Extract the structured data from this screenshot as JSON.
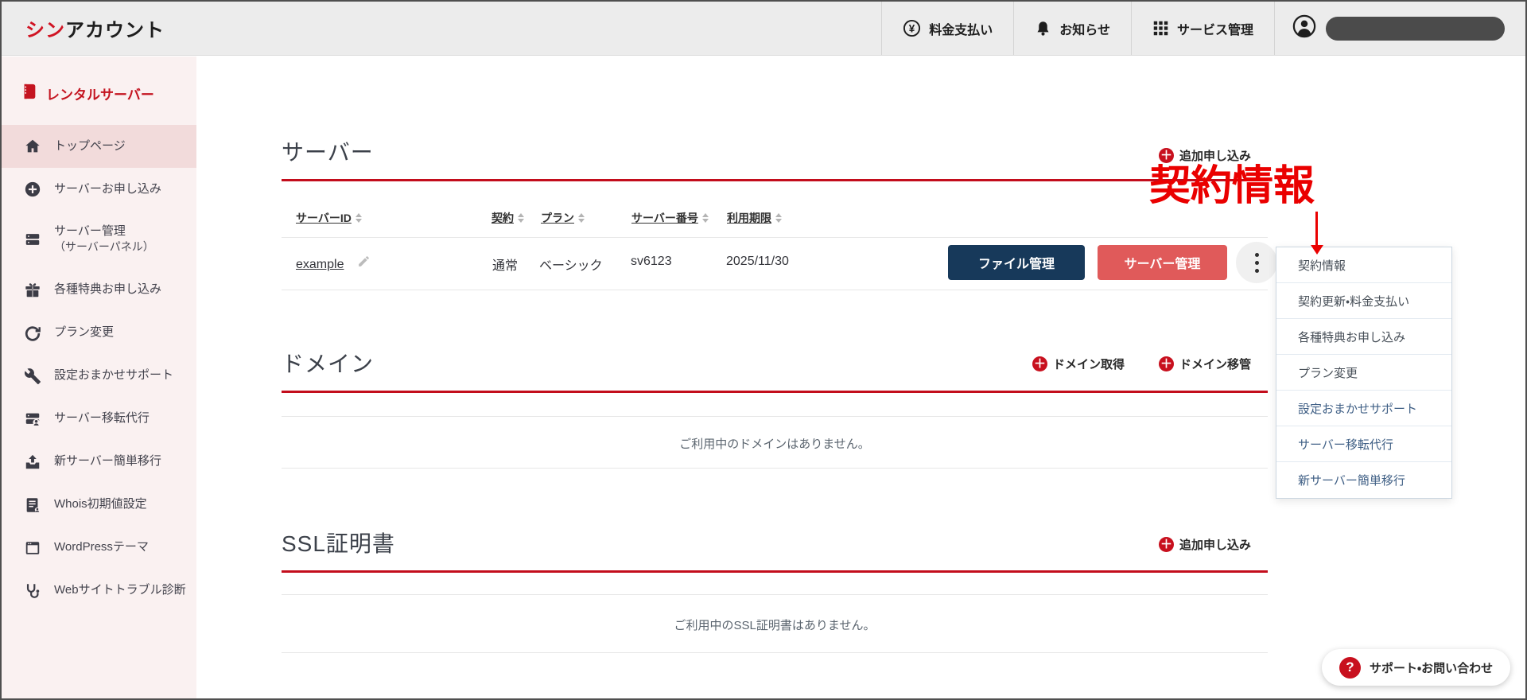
{
  "colors": {
    "brand_red": "#d01423",
    "accent_line_red": "#c30d1c",
    "annotation_red": "#ea0000",
    "navy_button": "#17395a",
    "salmon_button": "#e05a5a",
    "menu_link_blue": "#3f5f85",
    "sidebar_bg": "#faf1f1",
    "sidebar_active_bg": "#f2dbdb",
    "header_bg": "#ececec"
  },
  "header": {
    "logo_accent": "シン",
    "logo_rest": "アカウント",
    "nav": [
      {
        "label": "料金支払い",
        "icon": "yen-icon"
      },
      {
        "label": "お知らせ",
        "icon": "bell-icon"
      },
      {
        "label": "サービス管理",
        "icon": "grid-icon"
      }
    ]
  },
  "sidebar": {
    "title": "レンタルサーバー",
    "items": [
      {
        "label": "トップページ",
        "icon": "home-icon",
        "active": true
      },
      {
        "label": "サーバーお申し込み",
        "icon": "plus-circle-icon"
      },
      {
        "label": "サーバー管理",
        "sub": "（サーバーパネル）",
        "icon": "server-icon"
      },
      {
        "label": "各種特典お申し込み",
        "icon": "gift-icon"
      },
      {
        "label": "プラン変更",
        "icon": "refresh-icon"
      },
      {
        "label": "設定おまかせサポート",
        "icon": "wrench-icon"
      },
      {
        "label": "サーバー移転代行",
        "icon": "server-move-icon"
      },
      {
        "label": "新サーバー簡単移行",
        "icon": "migrate-icon"
      },
      {
        "label": "Whois初期値設定",
        "icon": "whois-doc-icon"
      },
      {
        "label": "WordPressテーマ",
        "icon": "browser-window-icon"
      },
      {
        "label": "Webサイトトラブル診断",
        "icon": "stethoscope-icon"
      }
    ]
  },
  "server_section": {
    "title": "サーバー",
    "add_label": "追加申し込み",
    "columns": [
      "サーバーID",
      "契約",
      "プラン",
      "サーバー番号",
      "利用期限"
    ],
    "row": {
      "server_id": "example",
      "contract": "通常",
      "plan": "ベーシック",
      "server_no": "sv6123",
      "expiry": "2025/11/30"
    },
    "file_manage_label": "ファイル管理",
    "server_manage_label": "サーバー管理"
  },
  "context_menu": {
    "items": [
      {
        "label": "契約情報"
      },
      {
        "label": "契約更新・料金支払い"
      },
      {
        "label": "各種特典お申し込み"
      },
      {
        "label": "プラン変更"
      },
      {
        "label": "設定おまかせサポート"
      },
      {
        "label": "サーバー移転代行"
      },
      {
        "label": "新サーバー簡単移行"
      }
    ]
  },
  "annotation": {
    "label": "契約情報"
  },
  "domain_section": {
    "title": "ドメイン",
    "get_label": "ドメイン取得",
    "transfer_label": "ドメイン移管",
    "empty_text": "ご利用中のドメインはありません。"
  },
  "ssl_section": {
    "title": "SSL証明書",
    "add_label": "追加申し込み",
    "empty_text": "ご利用中のSSL証明書はありません。"
  },
  "support": {
    "label": "サポート・お問い合わせ"
  }
}
